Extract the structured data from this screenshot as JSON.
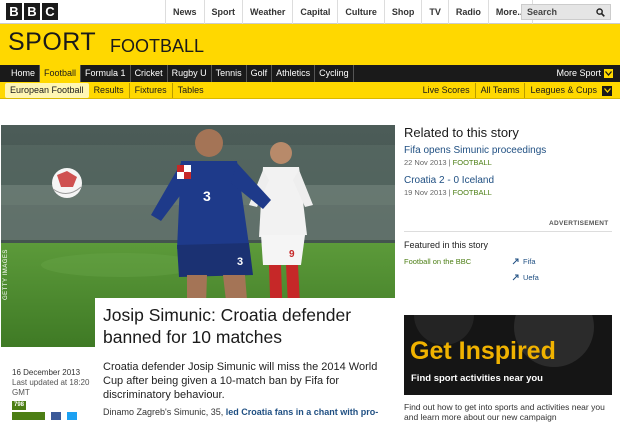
{
  "global_nav": {
    "logo_letters": [
      "B",
      "B",
      "C"
    ],
    "items": [
      "News",
      "Sport",
      "Weather",
      "Capital",
      "Culture",
      "Shop",
      "TV",
      "Radio",
      "More..."
    ],
    "search_placeholder": "Search"
  },
  "masthead": {
    "title": "SPORT",
    "section": "FOOTBALL",
    "bg_color": "#ffd800"
  },
  "sport_nav": {
    "items": [
      "Home",
      "Football",
      "Formula 1",
      "Cricket",
      "Rugby U",
      "Tennis",
      "Golf",
      "Athletics",
      "Cycling"
    ],
    "active": "Football",
    "more": "More Sport"
  },
  "sub_nav": {
    "left": [
      "European Football",
      "Results",
      "Fixtures",
      "Tables"
    ],
    "right": [
      "Live Scores",
      "All Teams",
      "Leagues & Cups"
    ]
  },
  "hero": {
    "credit": "GETTY IMAGES"
  },
  "article": {
    "headline": "Josip Simunic: Croatia defender banned for 10 matches",
    "date": "16 December 2013",
    "updated": "Last updated at 18:20 GMT",
    "comments": "798",
    "summary": "Croatia defender Josip Simunic will miss the 2014 World Cup after being given a 10-match ban by Fifa for discriminatory behaviour.",
    "body_start": "Dinamo Zagreb's Simunic, 35, ",
    "body_link": "led Croatia fans in a chant with pro-"
  },
  "related": {
    "title": "Related to this story",
    "items": [
      {
        "title": "Fifa opens Simunic proceedings",
        "date": "22 Nov 2013",
        "tag": "FOOTBALL"
      },
      {
        "title": "Croatia 2 - 0 Iceland",
        "date": "19 Nov 2013",
        "tag": "FOOTBALL"
      }
    ]
  },
  "advertisement_label": "ADVERTISEMENT",
  "featured": {
    "title": "Featured in this story",
    "source": "Football on the BBC",
    "links": [
      "Fifa",
      "Uefa"
    ]
  },
  "promo": {
    "headline": "Get Inspired",
    "tagline": "Find sport activities near you",
    "footer": "Find out how to get into sports and activities near you and learn more about our new campaign"
  }
}
